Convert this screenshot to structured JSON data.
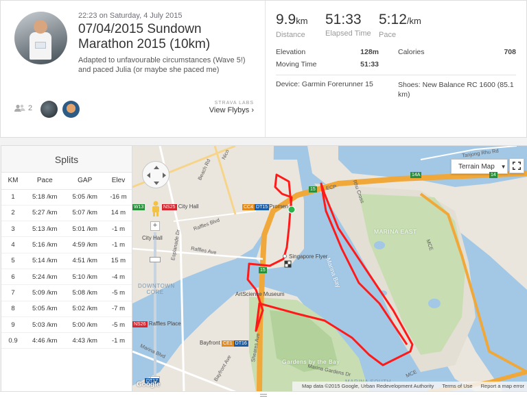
{
  "activity": {
    "datetime": "22:23 on Saturday, 4 July 2015",
    "title": "07/04/2015 Sundown Marathon 2015 (10km)",
    "description": "Adapted to unfavourable circumstances (Wave 5!) and paced Julia (or maybe she paced me)",
    "kudos_count": "2",
    "flyby_label": "STRAVA LABS",
    "flyby_link": "View Flybys ›"
  },
  "stats": {
    "distance_value": "9.9",
    "distance_unit": "km",
    "distance_label": "Distance",
    "elapsed_value": "51:33",
    "elapsed_label": "Elapsed Time",
    "pace_value": "5:12",
    "pace_unit": "/km",
    "pace_label": "Pace",
    "elevation_label": "Elevation",
    "elevation_value": "128m",
    "calories_label": "Calories",
    "calories_value": "708",
    "moving_label": "Moving Time",
    "moving_value": "51:33",
    "device": "Device: Garmin Forerunner 15",
    "shoes": "Shoes: New Balance RC 1600 (85.1 km)"
  },
  "splits": {
    "title": "Splits",
    "headers": [
      "KM",
      "Pace",
      "GAP",
      "Elev"
    ],
    "rows": [
      [
        "1",
        "5:18 /km",
        "5:05 /km",
        "-16 m"
      ],
      [
        "2",
        "5:27 /km",
        "5:07 /km",
        "14 m"
      ],
      [
        "3",
        "5:13 /km",
        "5:01 /km",
        "-1 m"
      ],
      [
        "4",
        "5:16 /km",
        "4:59 /km",
        "-1 m"
      ],
      [
        "5",
        "5:14 /km",
        "4:51 /km",
        "15 m"
      ],
      [
        "6",
        "5:24 /km",
        "5:10 /km",
        "-4 m"
      ],
      [
        "7",
        "5:09 /km",
        "5:08 /km",
        "-5 m"
      ],
      [
        "8",
        "5:05 /km",
        "5:02 /km",
        "-7 m"
      ],
      [
        "9",
        "5:03 /km",
        "5:00 /km",
        "-5 m"
      ],
      [
        "0.9",
        "4:46 /km",
        "4:43 /km",
        "-1 m"
      ]
    ]
  },
  "map": {
    "terrain_button": "Terrain Map",
    "labels": {
      "city_hall": "City Hall",
      "city_hall_2": "City Hall",
      "raffles_blvd": "Raffles Blvd",
      "raffles_ave": "Raffles Ave",
      "esplanade_dr": "Esplanade Dr",
      "downtown_core": "DOWNTOWN CORE",
      "raffles_place": "Raffles Place",
      "marina_blvd": "Marina Blvd",
      "promenade": "Promen",
      "singapore_flyer": "Singapore Flyer",
      "art_science": "ArtScience Museum",
      "marina_bay": "Marina Bay",
      "bayfront": "Bayfront",
      "sheares_ave": "Sheares Ave",
      "gardens_by_bay": "Gardens by the Bay",
      "marina_gardens_dr": "Marina Gardens Dr",
      "marina_south": "MARINA SOUTH",
      "marina_east": "MARINA EAST",
      "tanjong_rhu": "Tanjong Rhu Rd",
      "rhu_cross": "Rhu Cross",
      "mce": "MCE",
      "mce2": "MCE",
      "ecp": "ECP",
      "beach_rd": "Beach Rd",
      "nicoll": "Nico",
      "bayfront_ave": "Bayfront Ave",
      "google": "Google"
    },
    "stations": {
      "ns25": "NS25",
      "ew13": "W13",
      "ns25b": "NS25",
      "cc4": "CC4",
      "dt15": "DT15",
      "ns26": "NS26",
      "ce1": "CE1",
      "dt16": "DT16",
      "dt17": "DT17"
    },
    "road_numbers": {
      "r15a": "15",
      "r15b": "15",
      "r14a": "14A",
      "r14": "14"
    },
    "attribution": {
      "data": "Map data ©2015 Google, Urban Redevelopment Authority",
      "terms": "Terms of Use",
      "report": "Report a map error"
    },
    "colors": {
      "route": "#ff0000",
      "water": "#a3c8e6",
      "park": "#c8deb2",
      "highway": "#f0a83a",
      "start": "#2bb24c"
    }
  }
}
